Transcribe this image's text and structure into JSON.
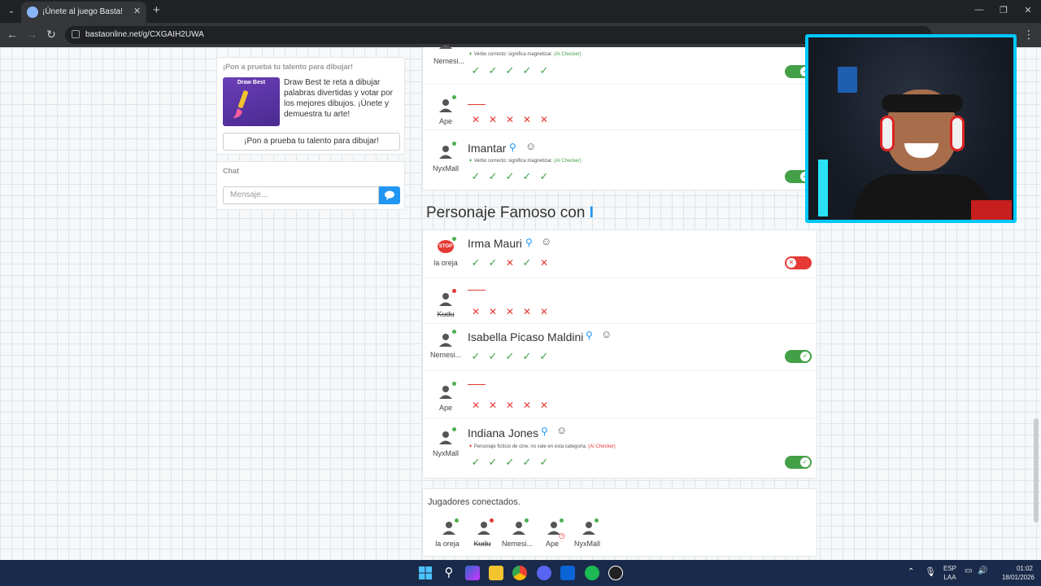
{
  "browser": {
    "tab_title": "¡Únete al juego Basta!",
    "tab_close": "✕",
    "new_tab": "+",
    "url": "bastaonline.net/g/CXGAIH2UWA"
  },
  "sidebar": {
    "promo_heading": "¡Pon a prueba tu talento para dibujar!",
    "promo_image_title": "Draw Best",
    "promo_text": "Draw Best te reta a dibujar palabras divertidas y votar por los mejores dibujos. ¡Únete y demuestra tu arte!",
    "promo_button": "¡Pon a prueba tu talento para dibujar!",
    "chat_heading": "Chat",
    "chat_placeholder": "Mensaje..."
  },
  "colors": {
    "accent": "#2196f3",
    "valid": "#43a047",
    "invalid": "#e53935",
    "webcam_border": "#00c8ff"
  },
  "category_1": {
    "rows": [
      {
        "player": "Nemesi...",
        "word": "",
        "note_label": "Verbo correcto: significa magnetizar.",
        "note_tag": "(AI Checker)",
        "votes": [
          "ok",
          "ok",
          "ok",
          "ok",
          "ok"
        ],
        "toggle": "on"
      },
      {
        "player": "Ape",
        "word": "",
        "votes": [
          "x",
          "x",
          "x",
          "x",
          "x"
        ]
      },
      {
        "player": "NyxMall",
        "word": "Imantar",
        "note_label": "Verbo correcto: significa magnetizar.",
        "note_tag": "(AI Checker)",
        "votes": [
          "ok",
          "ok",
          "ok",
          "ok",
          "ok"
        ],
        "toggle": "on"
      }
    ]
  },
  "category_2": {
    "title": "Personaje Famoso con",
    "letter": "I",
    "rows": [
      {
        "player": "la oreja",
        "word": "Irma Mauri",
        "stop": "STOP",
        "votes": [
          "ok",
          "ok",
          "x",
          "ok",
          "x"
        ],
        "toggle": "off"
      },
      {
        "player": "Kudu",
        "word": "",
        "votes": [
          "x",
          "x",
          "x",
          "x",
          "x"
        ]
      },
      {
        "player": "Nemesi...",
        "word": "Isabella Picaso Maldini",
        "votes": [
          "ok",
          "ok",
          "ok",
          "ok",
          "ok"
        ],
        "toggle": "on"
      },
      {
        "player": "Ape",
        "word": "",
        "votes": [
          "x",
          "x",
          "x",
          "x",
          "x"
        ]
      },
      {
        "player": "NyxMall",
        "word": "Indiana Jones",
        "note_label": "Personaje ficticio de cine; no vale en esta categoría.",
        "note_tag": "(AI Checker)",
        "votes": [
          "ok",
          "ok",
          "ok",
          "ok",
          "ok"
        ],
        "toggle": "on"
      }
    ]
  },
  "players": {
    "title": "Jugadores conectados.",
    "list": [
      {
        "name": "la oreja",
        "status": "green"
      },
      {
        "name": "Kudu",
        "status": "red"
      },
      {
        "name": "Nemesi...",
        "status": "green"
      },
      {
        "name": "Ape",
        "status": "green"
      },
      {
        "name": "NyxMall",
        "status": "green"
      }
    ]
  },
  "taskbar": {
    "lang_1": "ESP",
    "lang_2": "LAA",
    "time": "01:02",
    "date": "18/01/2026"
  }
}
